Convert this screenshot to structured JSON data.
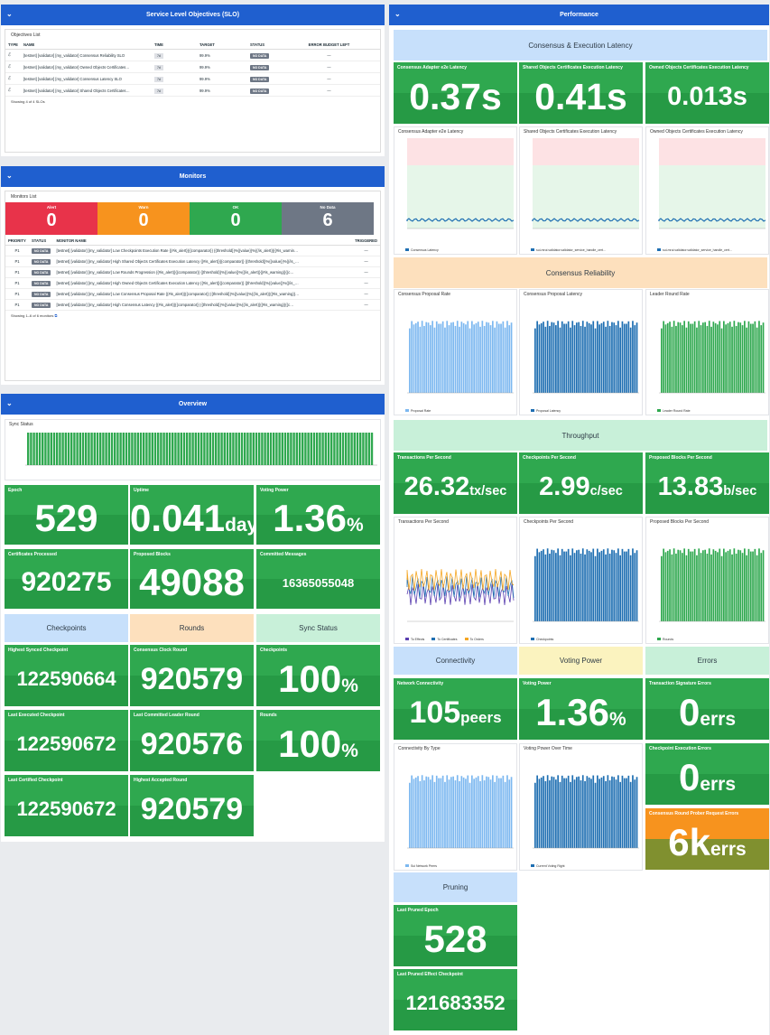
{
  "slo": {
    "title": "Service Level Objectives (SLO)",
    "list_title": "Objectives List",
    "headers": [
      "TYPE",
      "NAME",
      "TIME",
      "TARGET",
      "STATUS",
      "ERROR BUDGET LEFT"
    ],
    "rows": [
      {
        "name": "[testnet] [validator] [my_validator] Consensus Reliability SLO",
        "time": "7d",
        "target": "99.9%",
        "status": "NO DATA",
        "budget": "—"
      },
      {
        "name": "[testnet] [validator] [my_validator] Owned Objects Certificates…",
        "time": "7d",
        "target": "99.9%",
        "status": "NO DATA",
        "budget": "—"
      },
      {
        "name": "[testnet] [validator] [my_validator] Consensus Latency SLO",
        "time": "7d",
        "target": "99.9%",
        "status": "NO DATA",
        "budget": "—"
      },
      {
        "name": "[testnet] [validator] [my_validator] Shared Objects Certificates…",
        "time": "7d",
        "target": "99.9%",
        "status": "NO DATA",
        "budget": "—"
      }
    ],
    "footer": "Showing 4 of 4 SLOs"
  },
  "monitors": {
    "title": "Monitors",
    "list_title": "Monitors List",
    "counts": [
      {
        "label": "Alert",
        "value": "0",
        "color": "#e8334a"
      },
      {
        "label": "Warn",
        "value": "0",
        "color": "#f7931e"
      },
      {
        "label": "OK",
        "value": "0",
        "color": "#2fa84f"
      },
      {
        "label": "No Data",
        "value": "6",
        "color": "#6e7785"
      }
    ],
    "headers": [
      "PRIORITY",
      "STATUS",
      "MONITOR NAME",
      "TRIGGERED"
    ],
    "rows": [
      {
        "p": "P1",
        "status": "NO DATA",
        "name": "[testnet] [validator] [my_validator] Low Checkpoints Execution Rate {{#is_alert}}{{comparator}} {{threshold}}%{{value}}%{{/is_alert}}{{#is_warnin…",
        "trig": "—"
      },
      {
        "p": "P1",
        "status": "NO DATA",
        "name": "[testnet] [validator] [my_validator] High Shared Objects Certificates Execution Latency {{#is_alert}}{{comparator}} {{threshold}}%{{value}}%{{/is_…",
        "trig": "—"
      },
      {
        "p": "P1",
        "status": "NO DATA",
        "name": "[testnet] [validator] [my_validator] Low Rounds Progression {{#is_alert}}{{comparator}} {{threshold}}%{{value}}%{{/is_alert}}{{#is_warning}}{{c…",
        "trig": "—"
      },
      {
        "p": "P1",
        "status": "NO DATA",
        "name": "[testnet] [validator] [my_validator] High Owned Objects Certificates Execution Latency {{#is_alert}}{{comparator}} {{threshold}}%{{value}}%{{/is_…",
        "trig": "—"
      },
      {
        "p": "P1",
        "status": "NO DATA",
        "name": "[testnet] [validator] [my_validator] Low Consensus Proposal Rate {{#is_alert}}{{comparator}} {{threshold}}%{{value}}%{{/is_alert}}{{#is_warning}}…",
        "trig": "—"
      },
      {
        "p": "P1",
        "status": "NO DATA",
        "name": "[testnet] [validator] [my_validator] High Consensus Latency {{#is_alert}}{{comparator}} {{threshold}}%{{value}}%{{/is_alert}}{{#is_warning}}{{c…",
        "trig": "—"
      }
    ],
    "footer": "Showing 1–6 of 6 monitors"
  },
  "overview": {
    "title": "Overview",
    "sync_title": "Sync Status",
    "tiles": [
      {
        "title": "Epoch",
        "value": "529",
        "unit": ""
      },
      {
        "title": "Uptime",
        "value": "0.041",
        "unit": "days"
      },
      {
        "title": "Voting Power",
        "value": "1.36",
        "unit": "%"
      },
      {
        "title": "Certificates Processed",
        "value": "920275",
        "unit": ""
      },
      {
        "title": "Proposed Blocks",
        "value": "49088",
        "unit": ""
      },
      {
        "title": "Committed Messages",
        "value": "16365055048",
        "unit": ""
      }
    ],
    "groups": [
      "Checkpoints",
      "Rounds",
      "Sync Status"
    ],
    "group_tiles": [
      {
        "title": "Highest Synced Checkpoint",
        "value": "122590664",
        "unit": ""
      },
      {
        "title": "Consensus Clock Round",
        "value": "920579",
        "unit": ""
      },
      {
        "title": "Checkpoints",
        "value": "100",
        "unit": "%"
      },
      {
        "title": "Last Executed Checkpoint",
        "value": "122590672",
        "unit": ""
      },
      {
        "title": "Last Committed Leader Round",
        "value": "920576",
        "unit": ""
      },
      {
        "title": "Rounds",
        "value": "100",
        "unit": "%"
      },
      {
        "title": "Last Certified Checkpoint",
        "value": "122590672",
        "unit": ""
      },
      {
        "title": "Highest Accepted Round",
        "value": "920579",
        "unit": ""
      }
    ]
  },
  "performance": {
    "title": "Performance",
    "latency_group": "Consensus & Execution Latency",
    "latency_tiles": [
      {
        "title": "Consensus Adapter e2e Latency",
        "value": "0.37s"
      },
      {
        "title": "Shared Objects Certificates Execution Latency",
        "value": "0.41s"
      },
      {
        "title": "Owned Objects Certificates Execution Latency",
        "value": "0.013s"
      }
    ],
    "latency_charts": [
      {
        "title": "Consensus Adapter e2e Latency",
        "legend": "Consensus Latency"
      },
      {
        "title": "Shared Objects Certificates Execution Latency",
        "legend": "sui-mrui.validator.validator_service_handle_cert..."
      },
      {
        "title": "Owned Objects Certificates Execution Latency",
        "legend": "sui-mrui.validator.validator_service_handle_cert..."
      }
    ],
    "reliability_group": "Consensus Reliability",
    "reliability_charts": [
      {
        "title": "Consensus Proposal Rate",
        "legend": "Proposal Rate",
        "color": "#7db8f0"
      },
      {
        "title": "Consensus Proposal Latency",
        "legend": "Proposal Latency",
        "color": "#1f6fb2"
      },
      {
        "title": "Leader Round Rate",
        "legend": "Leader Round Rate",
        "color": "#2fa84f"
      }
    ],
    "throughput_group": "Throughput",
    "throughput_tiles": [
      {
        "title": "Transactions Per Second",
        "value": "26.32",
        "unit": "tx/sec"
      },
      {
        "title": "Checkpoints Per Second",
        "value": "2.99",
        "unit": "c/sec"
      },
      {
        "title": "Proposed Blocks Per Second",
        "value": "13.83",
        "unit": "b/sec"
      }
    ],
    "throughput_charts": [
      {
        "title": "Transactions Per Second",
        "legend": [
          "To Effects",
          "To Certificates",
          "To Orders"
        ]
      },
      {
        "title": "Checkpoints Per Second",
        "legend": [
          "Checkpoints"
        ]
      },
      {
        "title": "Proposed Blocks Per Second",
        "legend": [
          "Rounds"
        ]
      }
    ],
    "groups2": [
      "Connectivity",
      "Voting Power",
      "Errors"
    ],
    "conn_tile": {
      "title": "Network Connectivity",
      "value": "105",
      "unit": "peers"
    },
    "vp_tile": {
      "title": "Voting Power",
      "value": "1.36",
      "unit": "%"
    },
    "err_tiles": [
      {
        "title": "Transaction Signature Errors",
        "value": "0",
        "unit": "errs"
      },
      {
        "title": "Checkpoint Execution Errors",
        "value": "0",
        "unit": "errs"
      },
      {
        "title": "Consensus Round Prober Request Errors",
        "value": "6k",
        "unit": "errs"
      }
    ],
    "conn_chart": {
      "title": "Connectivity By Type",
      "legend": "Sui Network Peers"
    },
    "vp_chart": {
      "title": "Voting Power Over Time",
      "legend": "Current Voting Right"
    },
    "pruning_group": "Pruning",
    "pruning_tiles": [
      {
        "title": "Last Pruned Epoch",
        "value": "528"
      },
      {
        "title": "Last Pruned Effect Checkpoint",
        "value": "121683352"
      }
    ]
  },
  "colors": {
    "header": "#1f5fcf",
    "green": "#2fa84f",
    "orange": "#f7931e",
    "blue_group": "#c7e0fb",
    "orange_group": "#fde0bd",
    "green_group": "#c8f0d9",
    "yellow_group": "#fbf3bf"
  }
}
